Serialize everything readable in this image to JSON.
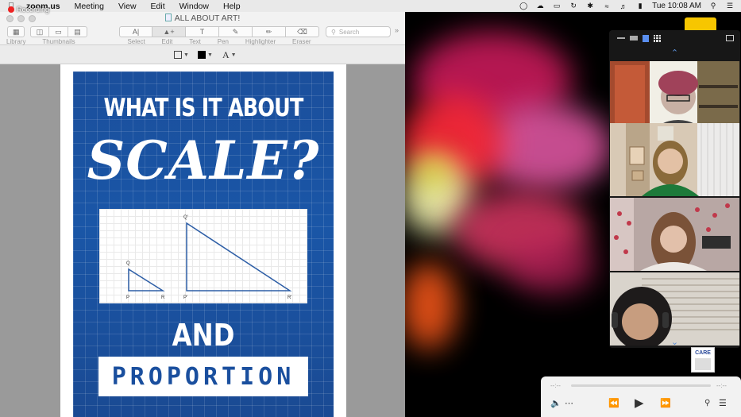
{
  "menubar": {
    "app_name": "zoom.us",
    "items": [
      "Meeting",
      "View",
      "Edit",
      "Window",
      "Help"
    ],
    "clock": "Tue 10:08 AM",
    "recording_label": "Recording"
  },
  "preview": {
    "title": "ALL ABOUT ART!",
    "toolbar": {
      "library_label": "Library",
      "thumbnails_label": "Thumbnails",
      "select_label": "Select",
      "edit_label": "Edit",
      "text_label": "Text",
      "pen_label": "Pen",
      "highlighter_label": "Highlighter",
      "eraser_label": "Eraser",
      "search_placeholder": "Search"
    },
    "poster": {
      "heading": "WHAT IS IT ABOUT",
      "scale_word": "SCALE?",
      "and_word": "AND",
      "proportion_word": "PROPORTION",
      "diagram_labels": {
        "small_top": "Q",
        "small_left": "P",
        "small_right": "R",
        "large_top": "Q'",
        "large_left": "P'",
        "large_right": "R'"
      }
    }
  },
  "care_thumb": {
    "label": "CARE"
  },
  "media": {
    "time_start": "--:--",
    "time_end": "--:--"
  },
  "colors": {
    "poster_blue": "#1a56a7",
    "zoom_accent": "#5b8fd8",
    "notification_yellow": "#f7c600"
  }
}
